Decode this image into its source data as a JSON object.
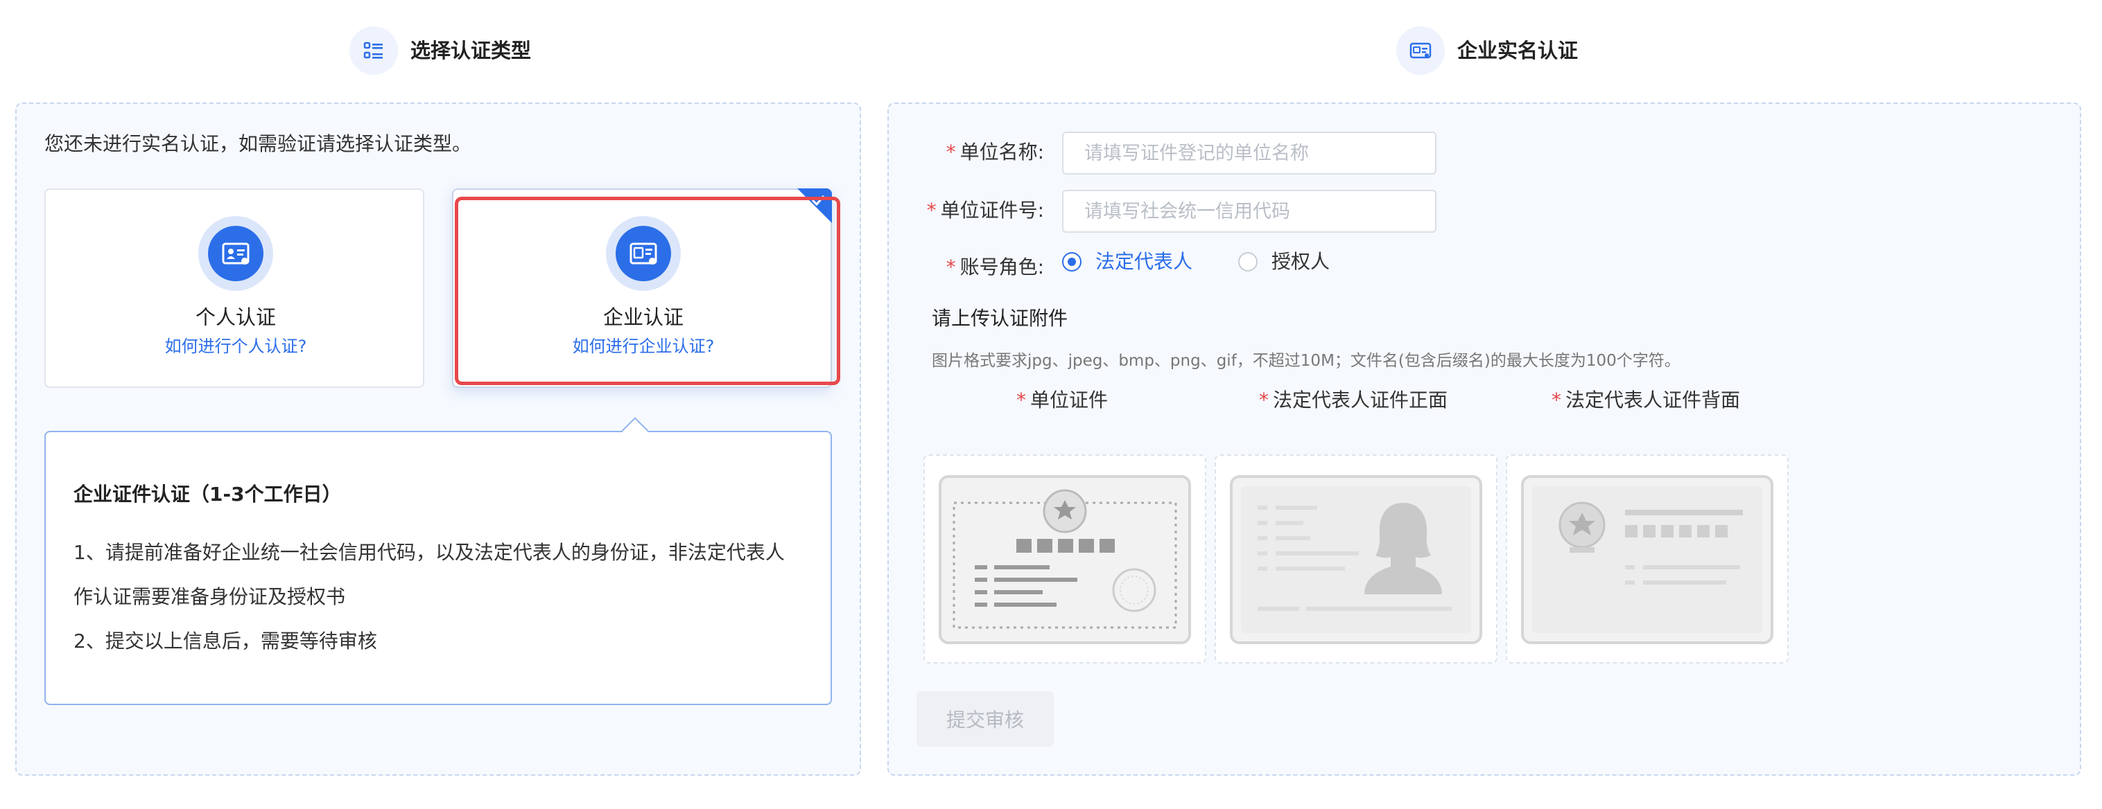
{
  "steps": {
    "select_type_label": "选择认证类型",
    "enterprise_label": "企业实名认证"
  },
  "left": {
    "intro": "您还未进行实名认证，如需验证请选择认证类型。",
    "cards": [
      {
        "title": "个人认证",
        "link": "如何进行个人认证?"
      },
      {
        "title": "企业认证",
        "link": "如何进行企业认证?"
      }
    ],
    "info": {
      "title": "企业证件认证（1-3个工作日）",
      "lines": [
        "1、请提前准备好企业统一社会信用代码，以及法定代表人的身份证，非法定代表人",
        "作认证需要准备身份证及授权书",
        "2、提交以上信息后，需要等待审核"
      ]
    }
  },
  "form": {
    "required_mark": "*",
    "unit_name_label": "单位名称:",
    "unit_name_placeholder": "请填写证件登记的单位名称",
    "unit_id_label": "单位证件号:",
    "unit_id_placeholder": "请填写社会统一信用代码",
    "role_label": "账号角色:",
    "role_options": [
      "法定代表人",
      "授权人"
    ],
    "upload_title": "请上传认证附件",
    "upload_hint": "图片格式要求jpg、jpeg、bmp、png、gif，不超过10M；文件名(包含后缀名)的最大长度为100个字符。",
    "uploads": [
      "单位证件",
      "法定代表人证件正面",
      "法定代表人证件背面"
    ],
    "submit_label": "提交审核"
  },
  "colors": {
    "primary": "#2b6ee8",
    "required": "#e8484b",
    "panel_bg": "#f6f9fe",
    "selected_outline": "#e8484b"
  }
}
